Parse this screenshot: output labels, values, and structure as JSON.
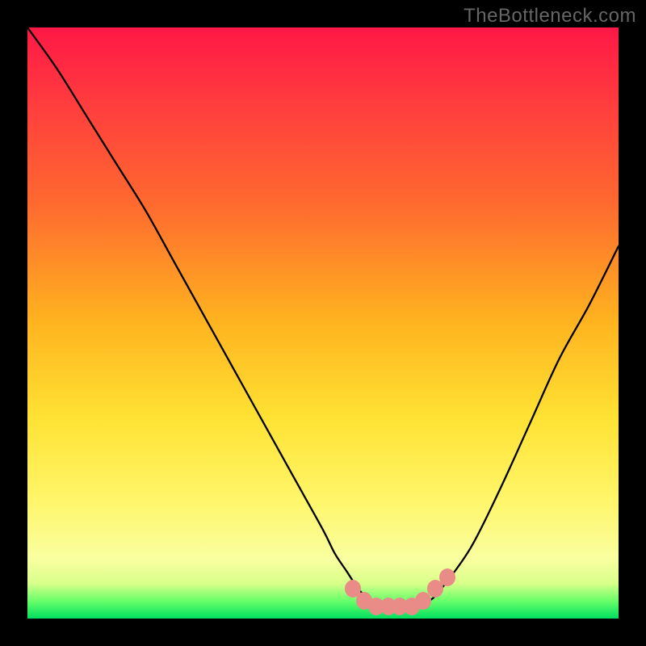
{
  "watermark": "TheBottleneck.com",
  "colors": {
    "page_bg": "#000000",
    "curve": "#000000",
    "marker": "#e98b86",
    "gradient_stops": [
      "#ff1846",
      "#ff3a3f",
      "#ff6a2f",
      "#ffb41f",
      "#ffe233",
      "#fff66a",
      "#f9ffa0",
      "#d9ff8a",
      "#6aff6a",
      "#00e060"
    ]
  },
  "chart_data": {
    "type": "line",
    "title": "",
    "xlabel": "",
    "ylabel": "",
    "xlim": [
      0,
      100
    ],
    "ylim": [
      0,
      100
    ],
    "grid": false,
    "legend": false,
    "series": [
      {
        "name": "curve",
        "x": [
          0,
          5,
          10,
          15,
          20,
          25,
          30,
          35,
          40,
          45,
          50,
          52,
          54,
          56,
          58,
          60,
          62,
          64,
          66,
          68,
          70,
          75,
          80,
          85,
          90,
          95,
          100
        ],
        "y": [
          100,
          93,
          85,
          77,
          69,
          60,
          51,
          42,
          33,
          24,
          15,
          11,
          8,
          5,
          3,
          2,
          2,
          2,
          2,
          3,
          5,
          12,
          22,
          33,
          44,
          53,
          63
        ]
      }
    ],
    "markers": [
      {
        "x": 55,
        "y": 5
      },
      {
        "x": 57,
        "y": 3
      },
      {
        "x": 59,
        "y": 2
      },
      {
        "x": 61,
        "y": 2
      },
      {
        "x": 63,
        "y": 2
      },
      {
        "x": 65,
        "y": 2
      },
      {
        "x": 67,
        "y": 3
      },
      {
        "x": 69,
        "y": 5
      },
      {
        "x": 71,
        "y": 7
      }
    ]
  }
}
